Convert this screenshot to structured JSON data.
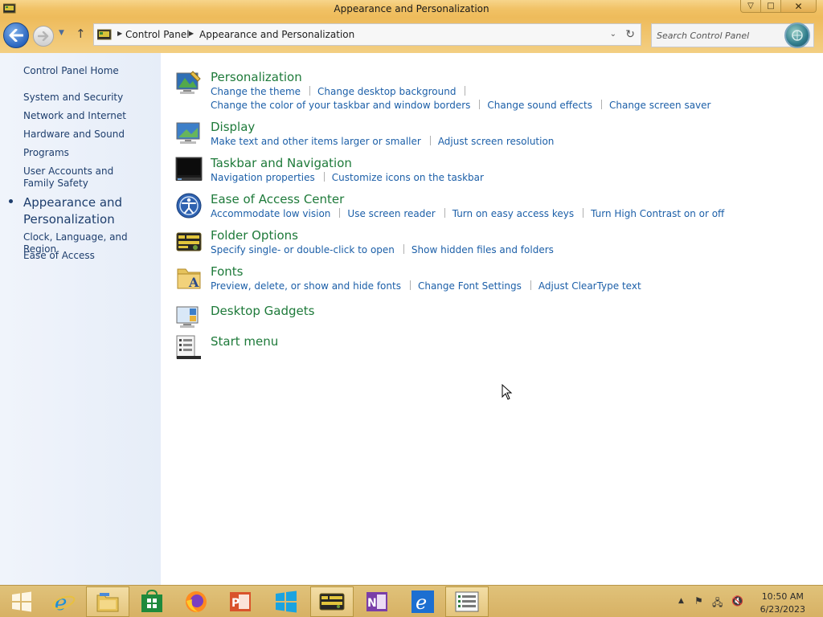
{
  "window": {
    "title": "Appearance and Personalization",
    "controls": {
      "minimize": "▽",
      "maximize": "□",
      "close": "✕"
    }
  },
  "nav": {
    "breadcrumb": [
      "Control Panel",
      "Appearance and Personalization"
    ],
    "search_placeholder": "Search Control Panel"
  },
  "sidebar": {
    "items": [
      {
        "label": "Control Panel Home"
      },
      {
        "label": "System and Security"
      },
      {
        "label": "Network and Internet"
      },
      {
        "label": "Hardware and Sound"
      },
      {
        "label": "Programs"
      },
      {
        "label": "User Accounts and Family Safety"
      },
      {
        "label": "Appearance and Personalization",
        "current": true
      },
      {
        "label": "Clock, Language, and Region"
      },
      {
        "label": "Ease of Access"
      }
    ]
  },
  "categories": [
    {
      "title": "Personalization",
      "icon": "personalization-icon",
      "links": [
        "Change the theme",
        "Change desktop background",
        "Change the color of your taskbar and window borders",
        "Change sound effects",
        "Change screen saver"
      ]
    },
    {
      "title": "Display",
      "icon": "display-icon",
      "links": [
        "Make text and other items larger or smaller",
        "Adjust screen resolution"
      ]
    },
    {
      "title": "Taskbar and Navigation",
      "icon": "taskbar-icon",
      "links": [
        "Navigation properties",
        "Customize icons on the taskbar"
      ]
    },
    {
      "title": "Ease of Access Center",
      "icon": "ease-of-access-icon",
      "links": [
        "Accommodate low vision",
        "Use screen reader",
        "Turn on easy access keys",
        "Turn High Contrast on or off"
      ]
    },
    {
      "title": "Folder Options",
      "icon": "folder-options-icon",
      "links": [
        "Specify single- or double-click to open",
        "Show hidden files and folders"
      ]
    },
    {
      "title": "Fonts",
      "icon": "fonts-icon",
      "links": [
        "Preview, delete, or show and hide fonts",
        "Change Font Settings",
        "Adjust ClearType text"
      ]
    },
    {
      "title": "Desktop Gadgets",
      "icon": "desktop-gadgets-icon",
      "links": []
    },
    {
      "title": "Start menu",
      "icon": "start-menu-icon",
      "links": []
    }
  ],
  "taskbar": {
    "apps": [
      "start-button",
      "internet-explorer-icon",
      "file-explorer-icon",
      "store-icon",
      "firefox-icon",
      "powerpoint-icon",
      "windows-icon",
      "control-panel-icon",
      "onenote-icon",
      "internet-explorer-icon",
      "task-list-icon"
    ],
    "clock": {
      "time": "10:50 AM",
      "date": "6/23/2023"
    }
  },
  "colors": {
    "titlebar": "#f1c266",
    "link": "#1c5fa8",
    "heading": "#1e7a3a",
    "sidebar_text": "#1e3e6d",
    "taskbar": "#dcb96e"
  }
}
